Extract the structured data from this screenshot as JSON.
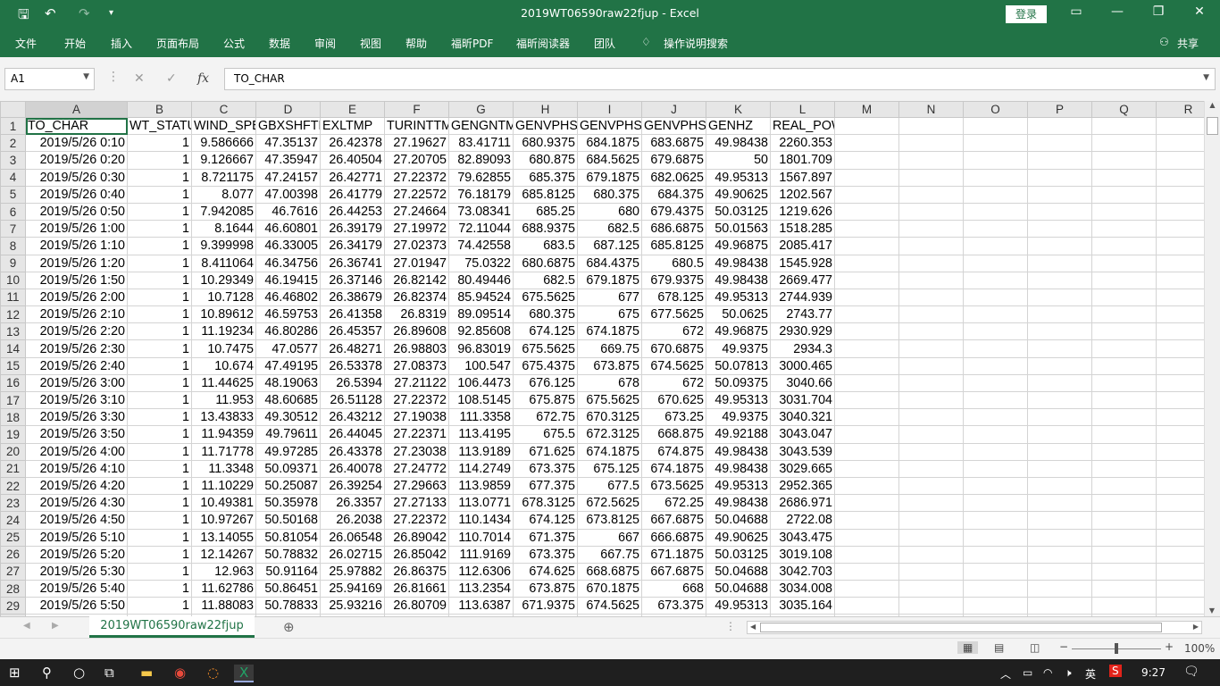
{
  "window": {
    "title": "2019WT06590raw22fjup  -  Excel",
    "login": "登录",
    "accent": "#217346"
  },
  "ribbon": {
    "tabs": [
      "文件",
      "开始",
      "插入",
      "页面布局",
      "公式",
      "数据",
      "审阅",
      "视图",
      "帮助",
      "福昕PDF",
      "福昕阅读器",
      "团队",
      "操作说明搜索"
    ],
    "share": "共享"
  },
  "formula_bar": {
    "name_box": "A1",
    "fx": "fx",
    "content": "TO_CHAR"
  },
  "columns": [
    "A",
    "B",
    "C",
    "D",
    "E",
    "F",
    "G",
    "H",
    "I",
    "J",
    "K",
    "L",
    "M",
    "N",
    "O",
    "P",
    "Q",
    "R"
  ],
  "headers": [
    "TO_CHAR",
    "WT_STATU",
    "WIND_SPE",
    "GBXSHFTM",
    "EXLTMP",
    "TURINTTM",
    "GENGNTM",
    "GENVPHSA",
    "GENVPHSE",
    "GENVPHSC",
    "GENHZ",
    "REAL_POWER"
  ],
  "rows": [
    [
      "2019/5/26 0:10",
      "1",
      "9.586666",
      "47.35137",
      "26.42378",
      "27.19627",
      "83.41711",
      "680.9375",
      "684.1875",
      "683.6875",
      "49.98438",
      "2260.353"
    ],
    [
      "2019/5/26 0:20",
      "1",
      "9.126667",
      "47.35947",
      "26.40504",
      "27.20705",
      "82.89093",
      "680.875",
      "684.5625",
      "679.6875",
      "50",
      "1801.709"
    ],
    [
      "2019/5/26 0:30",
      "1",
      "8.721175",
      "47.24157",
      "26.42771",
      "27.22372",
      "79.62855",
      "685.375",
      "679.1875",
      "682.0625",
      "49.95313",
      "1567.897"
    ],
    [
      "2019/5/26 0:40",
      "1",
      "8.077",
      "47.00398",
      "26.41779",
      "27.22572",
      "76.18179",
      "685.8125",
      "680.375",
      "684.375",
      "49.90625",
      "1202.567"
    ],
    [
      "2019/5/26 0:50",
      "1",
      "7.942085",
      "46.7616",
      "26.44253",
      "27.24664",
      "73.08341",
      "685.25",
      "680",
      "679.4375",
      "50.03125",
      "1219.626"
    ],
    [
      "2019/5/26 1:00",
      "1",
      "8.1644",
      "46.60801",
      "26.39179",
      "27.19972",
      "72.11044",
      "688.9375",
      "682.5",
      "686.6875",
      "50.01563",
      "1518.285"
    ],
    [
      "2019/5/26 1:10",
      "1",
      "9.399998",
      "46.33005",
      "26.34179",
      "27.02373",
      "74.42558",
      "683.5",
      "687.125",
      "685.8125",
      "49.96875",
      "2085.417"
    ],
    [
      "2019/5/26 1:20",
      "1",
      "8.411064",
      "46.34756",
      "26.36741",
      "27.01947",
      "75.0322",
      "680.6875",
      "684.4375",
      "680.5",
      "49.98438",
      "1545.928"
    ],
    [
      "2019/5/26 1:50",
      "1",
      "10.29349",
      "46.19415",
      "26.37146",
      "26.82142",
      "80.49446",
      "682.5",
      "679.1875",
      "679.9375",
      "49.98438",
      "2669.477"
    ],
    [
      "2019/5/26 2:00",
      "1",
      "10.7128",
      "46.46802",
      "26.38679",
      "26.82374",
      "85.94524",
      "675.5625",
      "677",
      "678.125",
      "49.95313",
      "2744.939"
    ],
    [
      "2019/5/26 2:10",
      "1",
      "10.89612",
      "46.59753",
      "26.41358",
      "26.8319",
      "89.09514",
      "680.375",
      "675",
      "677.5625",
      "50.0625",
      "2743.77"
    ],
    [
      "2019/5/26 2:20",
      "1",
      "11.19234",
      "46.80286",
      "26.45357",
      "26.89608",
      "92.85608",
      "674.125",
      "674.1875",
      "672",
      "49.96875",
      "2930.929"
    ],
    [
      "2019/5/26 2:30",
      "1",
      "10.7475",
      "47.0577",
      "26.48271",
      "26.98803",
      "96.83019",
      "675.5625",
      "669.75",
      "670.6875",
      "49.9375",
      "2934.3"
    ],
    [
      "2019/5/26 2:40",
      "1",
      "10.674",
      "47.49195",
      "26.53378",
      "27.08373",
      "100.547",
      "675.4375",
      "673.875",
      "674.5625",
      "50.07813",
      "3000.465"
    ],
    [
      "2019/5/26 3:00",
      "1",
      "11.44625",
      "48.19063",
      "26.5394",
      "27.21122",
      "106.4473",
      "676.125",
      "678",
      "672",
      "50.09375",
      "3040.66"
    ],
    [
      "2019/5/26 3:10",
      "1",
      "11.953",
      "48.60685",
      "26.51128",
      "27.22372",
      "108.5145",
      "675.875",
      "675.5625",
      "670.625",
      "49.95313",
      "3031.704"
    ],
    [
      "2019/5/26 3:30",
      "1",
      "13.43833",
      "49.30512",
      "26.43212",
      "27.19038",
      "111.3358",
      "672.75",
      "670.3125",
      "673.25",
      "49.9375",
      "3040.321"
    ],
    [
      "2019/5/26 3:50",
      "1",
      "11.94359",
      "49.79611",
      "26.44045",
      "27.22371",
      "113.4195",
      "675.5",
      "672.3125",
      "668.875",
      "49.92188",
      "3043.047"
    ],
    [
      "2019/5/26 4:00",
      "1",
      "11.71778",
      "49.97285",
      "26.43378",
      "27.23038",
      "113.9189",
      "671.625",
      "674.1875",
      "674.875",
      "49.98438",
      "3043.539"
    ],
    [
      "2019/5/26 4:10",
      "1",
      "11.3348",
      "50.09371",
      "26.40078",
      "27.24772",
      "114.2749",
      "673.375",
      "675.125",
      "674.1875",
      "49.98438",
      "3029.665"
    ],
    [
      "2019/5/26 4:20",
      "1",
      "11.10229",
      "50.25087",
      "26.39254",
      "27.29663",
      "113.9859",
      "677.375",
      "677.5",
      "673.5625",
      "49.95313",
      "2952.365"
    ],
    [
      "2019/5/26 4:30",
      "1",
      "10.49381",
      "50.35978",
      "26.3357",
      "27.27133",
      "113.0771",
      "678.3125",
      "672.5625",
      "672.25",
      "49.98438",
      "2686.971"
    ],
    [
      "2019/5/26 4:50",
      "1",
      "10.97267",
      "50.50168",
      "26.2038",
      "27.22372",
      "110.1434",
      "674.125",
      "673.8125",
      "667.6875",
      "50.04688",
      "2722.08"
    ],
    [
      "2019/5/26 5:10",
      "1",
      "13.14055",
      "50.81054",
      "26.06548",
      "26.89042",
      "110.7014",
      "671.375",
      "667",
      "666.6875",
      "49.90625",
      "3043.475"
    ],
    [
      "2019/5/26 5:20",
      "1",
      "12.14267",
      "50.78832",
      "26.02715",
      "26.85042",
      "111.9169",
      "673.375",
      "667.75",
      "671.1875",
      "50.03125",
      "3019.108"
    ],
    [
      "2019/5/26 5:30",
      "1",
      "12.963",
      "50.91164",
      "25.97882",
      "26.86375",
      "112.6306",
      "674.625",
      "668.6875",
      "667.6875",
      "50.04688",
      "3042.703"
    ],
    [
      "2019/5/26 5:40",
      "1",
      "11.62786",
      "50.86451",
      "25.94169",
      "26.81661",
      "113.2354",
      "673.875",
      "670.1875",
      "668",
      "50.04688",
      "3034.008"
    ],
    [
      "2019/5/26 5:50",
      "1",
      "11.88083",
      "50.78833",
      "25.93216",
      "26.80709",
      "113.6387",
      "671.9375",
      "674.5625",
      "673.375",
      "49.95313",
      "3035.164"
    ]
  ],
  "sheet": {
    "tab": "2019WT06590raw22fjup",
    "add": "⊕"
  },
  "status": {
    "zoom": "100%"
  },
  "taskbar": {
    "ime": "英",
    "time": "9:27"
  }
}
